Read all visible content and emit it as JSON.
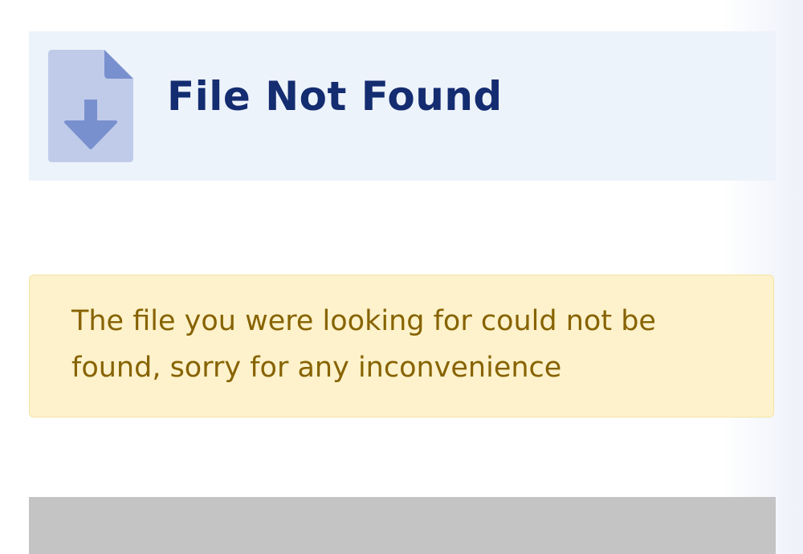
{
  "header": {
    "icon": "file-download-icon",
    "title": "File Not Found"
  },
  "alert": {
    "message": "The file you were looking for could not be found, sorry for any inconvenience"
  },
  "colors": {
    "header_bg": "#edf3fb",
    "title": "#142c70",
    "icon_light": "#c0cbe9",
    "icon_dark": "#7990cf",
    "alert_bg": "#fdf2cb",
    "alert_border": "#f4e3a7",
    "alert_text": "#876300",
    "footer_bg": "#c4c4c4"
  }
}
